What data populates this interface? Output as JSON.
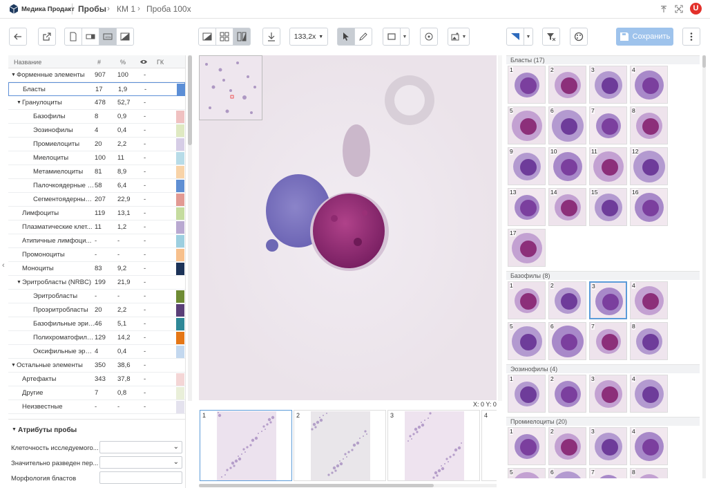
{
  "header": {
    "brand": "Медика Продакт",
    "breadcrumbs": [
      "Пробы",
      "КМ 1",
      "Проба 100х"
    ]
  },
  "toolbar": {
    "zoom": "133,2x",
    "save_label": "Сохранить"
  },
  "table": {
    "headers": [
      "Название",
      "#",
      "%",
      "",
      "ГК"
    ],
    "rows": [
      {
        "name": "Форменные элементы",
        "count": "907",
        "pct": "100",
        "gk": "-",
        "level": 0,
        "caret": true,
        "color": ""
      },
      {
        "name": "Бласты",
        "count": "17",
        "pct": "1,9",
        "gk": "-",
        "level": 1,
        "caret": false,
        "color": "#5b8ed6"
      },
      {
        "name": "Гранулоциты",
        "count": "478",
        "pct": "52,7",
        "gk": "-",
        "level": 1,
        "caret": true,
        "color": ""
      },
      {
        "name": "Базофилы",
        "count": "8",
        "pct": "0,9",
        "gk": "-",
        "level": 2,
        "caret": false,
        "color": "#f0c1c1"
      },
      {
        "name": "Эозинофилы",
        "count": "4",
        "pct": "0,4",
        "gk": "-",
        "level": 2,
        "caret": false,
        "color": "#dfe9c2"
      },
      {
        "name": "Промиелоциты",
        "count": "20",
        "pct": "2,2",
        "gk": "-",
        "level": 2,
        "caret": false,
        "color": "#d6cde6"
      },
      {
        "name": "Миелоциты",
        "count": "100",
        "pct": "11",
        "gk": "-",
        "level": 2,
        "caret": false,
        "color": "#b7dce8"
      },
      {
        "name": "Метамиелоциты",
        "count": "81",
        "pct": "8,9",
        "gk": "-",
        "level": 2,
        "caret": false,
        "color": "#f8d3a8"
      },
      {
        "name": "Палочкоядерные н...",
        "count": "58",
        "pct": "6,4",
        "gk": "-",
        "level": 2,
        "caret": false,
        "color": "#5f8fd3"
      },
      {
        "name": "Сегментоядерные ...",
        "count": "207",
        "pct": "22,9",
        "gk": "-",
        "level": 2,
        "caret": false,
        "color": "#e29a93"
      },
      {
        "name": "Лимфоциты",
        "count": "119",
        "pct": "13,1",
        "gk": "-",
        "level": 1,
        "caret": false,
        "color": "#c5dc9f"
      },
      {
        "name": "Плазматические клет...",
        "count": "11",
        "pct": "1,2",
        "gk": "-",
        "level": 1,
        "caret": false,
        "color": "#b9a9d1"
      },
      {
        "name": "Атипичные лимфоци...",
        "count": "-",
        "pct": "-",
        "gk": "-",
        "level": 1,
        "caret": false,
        "color": "#9dcfe0"
      },
      {
        "name": "Промоноциты",
        "count": "-",
        "pct": "-",
        "gk": "-",
        "level": 1,
        "caret": false,
        "color": "#f7c08c"
      },
      {
        "name": "Моноциты",
        "count": "83",
        "pct": "9,2",
        "gk": "-",
        "level": 1,
        "caret": false,
        "color": "#1c3358"
      },
      {
        "name": "Эритробласты (NRBC)",
        "count": "199",
        "pct": "21,9",
        "gk": "-",
        "level": 1,
        "caret": true,
        "color": ""
      },
      {
        "name": "Эритробласты",
        "count": "-",
        "pct": "-",
        "gk": "-",
        "level": 2,
        "caret": false,
        "color": "#6e8b34"
      },
      {
        "name": "Проэритробласты",
        "count": "20",
        "pct": "2,2",
        "gk": "-",
        "level": 2,
        "caret": false,
        "color": "#5a3f78"
      },
      {
        "name": "Базофильные эритр...",
        "count": "46",
        "pct": "5,1",
        "gk": "-",
        "level": 2,
        "caret": false,
        "color": "#2f8897"
      },
      {
        "name": "Полихроматофильн...",
        "count": "129",
        "pct": "14,2",
        "gk": "-",
        "level": 2,
        "caret": false,
        "color": "#e57716"
      },
      {
        "name": "Оксифильные эрит...",
        "count": "4",
        "pct": "0,4",
        "gk": "-",
        "level": 2,
        "caret": false,
        "color": "#c3d8ef"
      },
      {
        "name": "Остальные элементы",
        "count": "350",
        "pct": "38,6",
        "gk": "-",
        "level": 0,
        "caret": true,
        "color": ""
      },
      {
        "name": "Артефакты",
        "count": "343",
        "pct": "37,8",
        "gk": "-",
        "level": 1,
        "caret": false,
        "color": "#f4d6d6"
      },
      {
        "name": "Другие",
        "count": "7",
        "pct": "0,8",
        "gk": "-",
        "level": 1,
        "caret": false,
        "color": "#e9efd9"
      },
      {
        "name": "Неизвестные",
        "count": "-",
        "pct": "-",
        "gk": "-",
        "level": 1,
        "caret": false,
        "color": "#e4e2ee"
      }
    ]
  },
  "attributes": {
    "title": "Атрибуты пробы",
    "items": [
      "Клеточность исследуемого...",
      "Значительно разведен пер...",
      "Морфология бластов"
    ]
  },
  "viewer": {
    "coords": "X: 0 Y: 0",
    "thumbs": [
      "1",
      "2",
      "3",
      "4"
    ]
  },
  "gallery": {
    "sections": [
      {
        "title": "Бласты (17)",
        "count": 17
      },
      {
        "title": "Базофилы (8)",
        "count": 8
      },
      {
        "title": "Эозинофилы (4)",
        "count": 4
      },
      {
        "title": "Промиелоциты (20)",
        "count": 8
      }
    ]
  },
  "colors": {
    "accent": "#5b9bd8",
    "save_bg": "#9ec3ec",
    "logo_red": "#e3312b"
  }
}
